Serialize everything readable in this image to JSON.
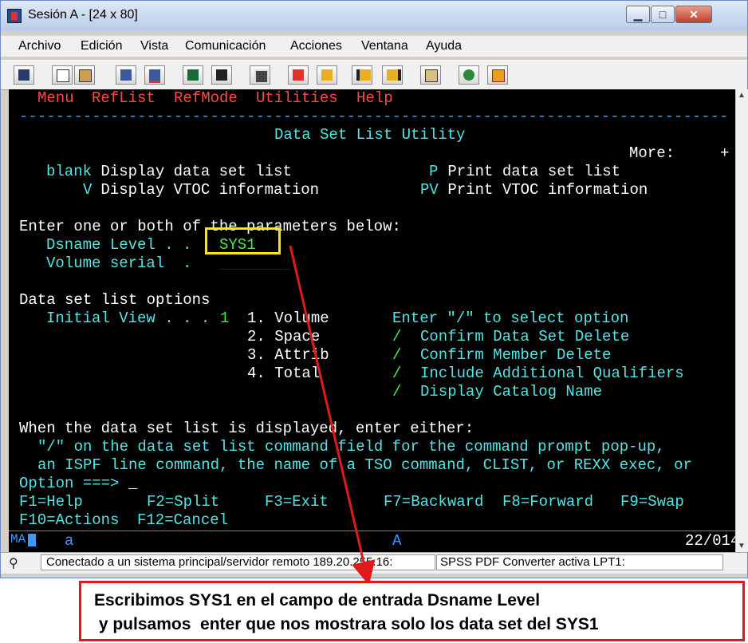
{
  "window": {
    "title": "Sesión A - [24 x 80]",
    "min_glyph": "▁",
    "max_glyph": "□",
    "close_glyph": "✕"
  },
  "menubar": [
    "Archivo",
    "Edición",
    "Vista",
    "Comunicación",
    "Acciones",
    "Ventana",
    "Ayuda"
  ],
  "toolbar_icons": [
    "print-screen-icon",
    "copy-icon",
    "paste-icon",
    "send-icon",
    "receive-icon",
    "display-icon",
    "keyboard-icon",
    "macro-icon",
    "record-macro-icon",
    "play-macro-icon",
    "stop-macro-icon",
    "clipboard-icon",
    "globe-icon",
    "support-icon"
  ],
  "terminal": {
    "menu": [
      "Menu",
      "RefList",
      "RefMode",
      "Utilities",
      "Help"
    ],
    "separator": "------------------------------------------------------------------------------",
    "header": "Data Set List Utility",
    "more": "More:     +",
    "opt_blank_key": "blank",
    "opt_blank_text": " Display data set list",
    "opt_p_key": "P",
    "opt_p_text": " Print data set list",
    "opt_v_key": "V",
    "opt_v_text": " Display VTOC information",
    "opt_pv_key": "PV",
    "opt_pv_text": " Print VTOC information",
    "enter_params": "Enter one or both of the parameters below:",
    "dsname_label": "Dsname Level . .",
    "dsname_value": "SYS1",
    "volume_label": "Volume serial  .",
    "dsl_options": "Data set list options",
    "initial_view_label": "Initial View . . .",
    "initial_view_value": "1",
    "view_options": [
      "1. Volume",
      "2. Space",
      "3. Attrib",
      "4. Total"
    ],
    "select_hint": "Enter \"/\" to select option",
    "checks": [
      {
        "mark": "/",
        "label": "Confirm Data Set Delete"
      },
      {
        "mark": "/",
        "label": "Confirm Member Delete"
      },
      {
        "mark": "/",
        "label": "Include Additional Qualifiers"
      },
      {
        "mark": "/",
        "label": "Display Catalog Name"
      }
    ],
    "when_line": "When the data set list is displayed, enter either:",
    "line2": "\"/\" on the data set list command field for the command prompt pop-up,",
    "line3": "an ISPF line command, the name of a TSO command, CLIST, or REXX exec, or",
    "option_prompt": "Option ===>",
    "cursor": "_",
    "fkeys_row1": [
      "F1=Help",
      "F2=Split",
      "F3=Exit",
      "F7=Backward",
      "F8=Forward",
      "F9=Swap"
    ],
    "fkeys_row2": [
      "F10=Actions",
      "F12=Cancel"
    ],
    "status_left": "MA",
    "status_a": "a",
    "status_mid": "A",
    "status_pos": "22/014"
  },
  "statusbar": {
    "connection": "Conectado a un sistema principal/servidor remoto 189.20.255.16:",
    "printer": "SPSS PDF Converter activa LPT1:"
  },
  "annotation": {
    "line1": "Escribimos SYS1 en el campo de entrada Dsname Level",
    "line2": " y pulsamos  enter que nos mostrara solo los data set del SYS1"
  },
  "colors": {
    "terminal_bg": "#000000",
    "terminal_text": "#55e4e4",
    "menu_red": "#ff4848",
    "input_green": "#44ee44",
    "highlight_yellow": "#ffe600",
    "arrow_red": "#e01a1a"
  }
}
